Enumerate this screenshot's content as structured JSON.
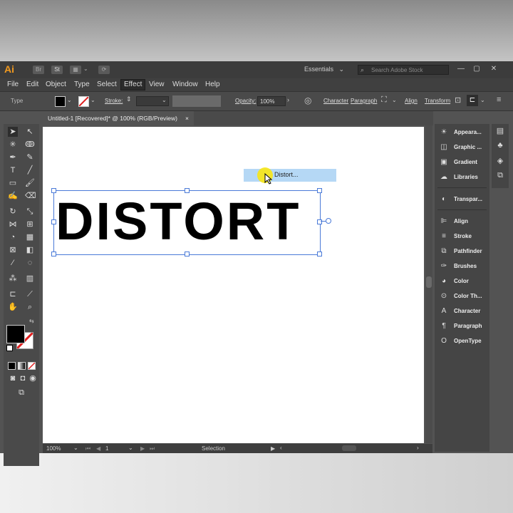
{
  "app": {
    "logo": "Ai",
    "bridge_icon": "Br",
    "stock_icon": "St",
    "workspace": "Essentials",
    "search_placeholder": "Search Adobe Stock",
    "window_buttons": [
      "—",
      "▢",
      "✕"
    ]
  },
  "menu": [
    "File",
    "Edit",
    "Object",
    "Type",
    "Select",
    "Effect",
    "View",
    "Window",
    "Help"
  ],
  "active_menu": "Effect",
  "control_bar": {
    "selection_type": "Type",
    "stroke_label": "Stroke:",
    "opacity_label": "Opacity:",
    "opacity_value": "100%",
    "links": [
      "Character",
      "Paragraph",
      "Align",
      "Transform"
    ]
  },
  "document_tab": {
    "title": "Untitled-1 [Recovered]* @ 100% (RGB/Preview)",
    "close": "×"
  },
  "canvas": {
    "text": "DISTORT",
    "menu_highlight": "Distort..."
  },
  "status_bar": {
    "zoom": "100%",
    "artboard_number": "1",
    "tool": "Selection"
  },
  "panels": [
    {
      "label": "Appeara...",
      "icon": "sun-icon"
    },
    {
      "label": "Graphic ...",
      "icon": "graphic-styles-icon"
    },
    {
      "label": "Gradient",
      "icon": "gradient-icon"
    },
    {
      "label": "Libraries",
      "icon": "libraries-icon"
    },
    {
      "label": "Transpar...",
      "icon": "transparency-icon"
    },
    {
      "label": "Align",
      "icon": "align-icon"
    },
    {
      "label": "Stroke",
      "icon": "stroke-icon"
    },
    {
      "label": "Pathfinder",
      "icon": "pathfinder-icon"
    },
    {
      "label": "Brushes",
      "icon": "brush-icon"
    },
    {
      "label": "Color",
      "icon": "color-icon"
    },
    {
      "label": "Color Th...",
      "icon": "color-theme-icon"
    },
    {
      "label": "Character",
      "icon": "character-icon"
    },
    {
      "label": "Paragraph",
      "icon": "paragraph-icon"
    },
    {
      "label": "OpenType",
      "icon": "opentype-icon"
    }
  ],
  "colors": {
    "accent": "#f29a1f",
    "selection": "#4a7ad8",
    "highlight": "#b5d8f5",
    "cursor_halo": "#f6e61f"
  }
}
